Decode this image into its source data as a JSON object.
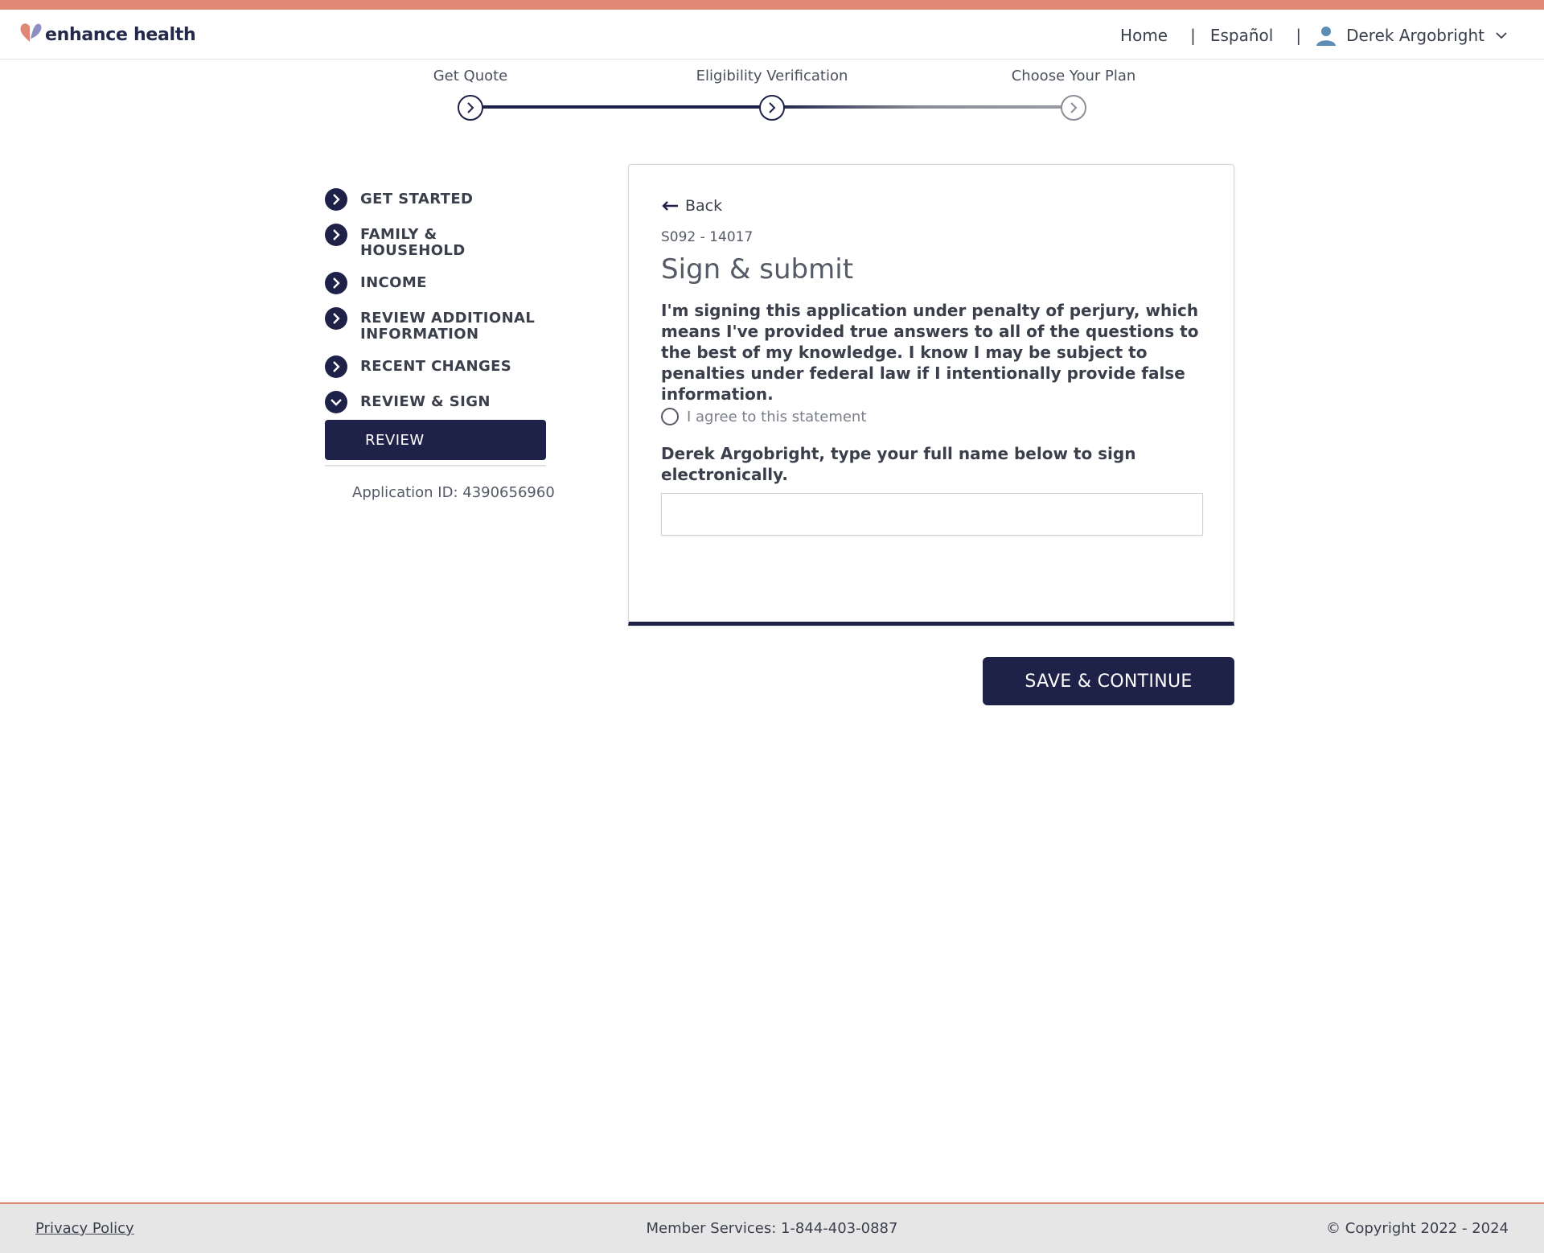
{
  "brand": {
    "name": "enhance health",
    "accent": "#df8876",
    "navy": "#1f2248"
  },
  "header": {
    "nav": {
      "home": "Home",
      "language": "Español",
      "separator": "|",
      "user_name": "Derek Argobright"
    }
  },
  "progress": {
    "steps": [
      {
        "label": "Get Quote",
        "state": "complete"
      },
      {
        "label": "Eligibility Verification",
        "state": "current"
      },
      {
        "label": "Choose Your Plan",
        "state": "upcoming"
      }
    ]
  },
  "sidebar": {
    "items": [
      {
        "label": "GET STARTED",
        "icon": "chevron-right-icon"
      },
      {
        "label": "FAMILY & HOUSEHOLD",
        "icon": "chevron-right-icon"
      },
      {
        "label": "INCOME",
        "icon": "chevron-right-icon"
      },
      {
        "label": "REVIEW ADDITIONAL INFORMATION",
        "icon": "chevron-right-icon"
      },
      {
        "label": "RECENT CHANGES",
        "icon": "chevron-right-icon"
      },
      {
        "label": "REVIEW & SIGN",
        "icon": "chevron-down-icon"
      }
    ],
    "sub_item": "REVIEW",
    "application_id": "Application ID: 4390656960"
  },
  "card": {
    "back": "Back",
    "code": "S092 - 14017",
    "title": "Sign & submit",
    "statement": "I'm signing this application under penalty of perjury, which means I've provided true answers to all of the questions to the best of my knowledge. I know I may be subject to penalties under federal law if I intentionally provide false information.",
    "agree_label": "I agree to this statement",
    "sign_label": "Derek Argobright, type your full name below to sign electronically.",
    "sign_value": ""
  },
  "actions": {
    "save_continue": "SAVE & CONTINUE"
  },
  "footer": {
    "privacy": "Privacy Policy",
    "services": "Member Services: 1-844-403-0887",
    "copyright": "© Copyright 2022 - 2024"
  }
}
